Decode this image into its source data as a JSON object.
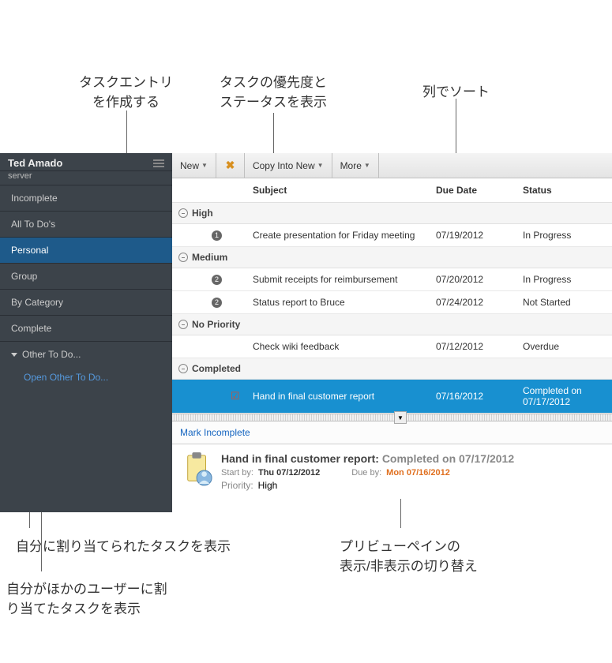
{
  "annotations": {
    "create": "タスクエントリ\nを作成する",
    "priority": "タスクの優先度と\nステータスを表示",
    "sort": "列でソート",
    "assigned_to_me": "自分に割り当てられたタスクを表示",
    "preview_toggle": "プリビューペインの\n表示/非表示の切り替え",
    "assigned_to_others": "自分がほかのユーザーに割\nり当てたタスクを表示"
  },
  "sidebar": {
    "user": "Ted Amado",
    "server": "server",
    "items": [
      "Incomplete",
      "All To Do's",
      "Personal",
      "Group",
      "By Category",
      "Complete"
    ],
    "other_label": "Other To Do...",
    "open_other": "Open Other To Do..."
  },
  "toolbar": {
    "new": "New",
    "copy": "Copy Into New",
    "more": "More"
  },
  "columns": {
    "subject": "Subject",
    "due": "Due Date",
    "status": "Status"
  },
  "groups": [
    {
      "name": "High",
      "tasks": [
        {
          "pri": "1",
          "subject": "Create presentation for Friday meeting",
          "due": "07/19/2012",
          "status": "In Progress"
        }
      ]
    },
    {
      "name": "Medium",
      "tasks": [
        {
          "pri": "2",
          "subject": "Submit receipts for reimbursement",
          "due": "07/20/2012",
          "status": "In Progress"
        },
        {
          "pri": "2",
          "subject": "Status report to Bruce",
          "due": "07/24/2012",
          "status": "Not Started"
        }
      ]
    },
    {
      "name": "No Priority",
      "tasks": [
        {
          "pri": "",
          "subject": "Check wiki feedback",
          "due": "07/12/2012",
          "status": "Overdue"
        }
      ]
    },
    {
      "name": "Completed",
      "tasks": [
        {
          "pri": "",
          "checked": true,
          "subject": "Hand in final customer report",
          "due": "07/16/2012",
          "status": "Completed on 07/17/2012",
          "selected": true
        }
      ]
    }
  ],
  "preview": {
    "mark": "Mark Incomplete",
    "title": "Hand in final customer report:",
    "completed": "Completed on 07/17/2012",
    "start_label": "Start by:",
    "start_val": "Thu 07/12/2012",
    "due_label": "Due by:",
    "due_val": "Mon 07/16/2012",
    "pri_label": "Priority:",
    "pri_val": "High"
  }
}
